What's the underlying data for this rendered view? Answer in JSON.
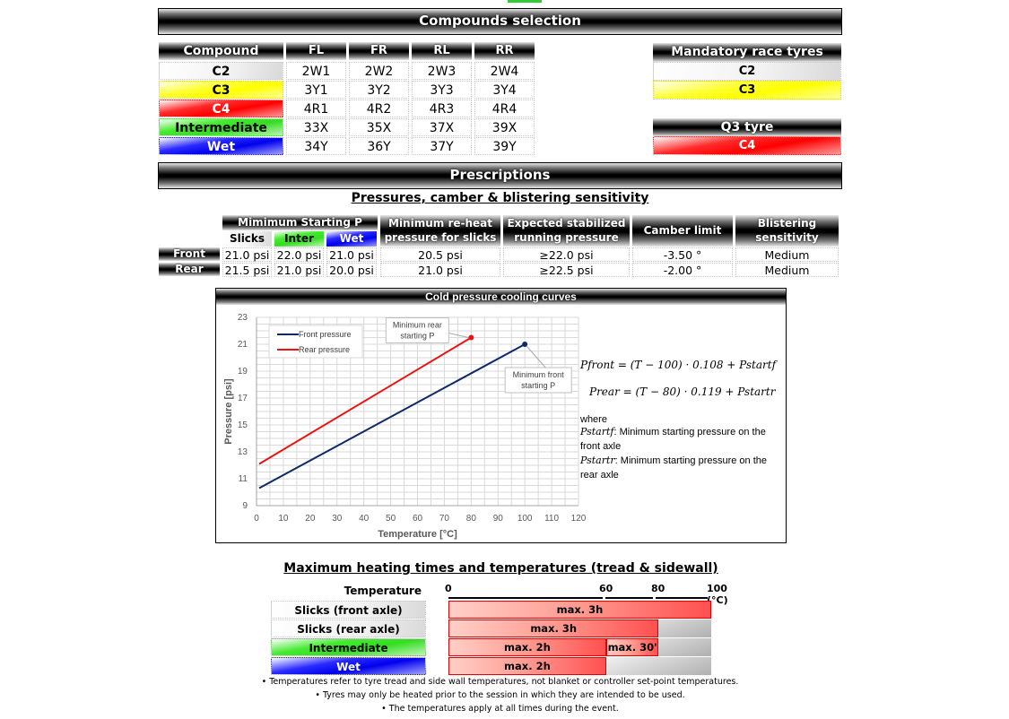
{
  "compounds_section": {
    "title": "Compounds selection",
    "table": {
      "headers": [
        "Compound",
        "FL",
        "FR",
        "RL",
        "RR"
      ],
      "rows": [
        {
          "compound": "C2",
          "color": "white",
          "FL": "2W1",
          "FR": "2W2",
          "RL": "2W3",
          "RR": "2W4"
        },
        {
          "compound": "C3",
          "color": "yellow",
          "FL": "3Y1",
          "FR": "3Y2",
          "RL": "3Y3",
          "RR": "3Y4"
        },
        {
          "compound": "C4",
          "color": "red",
          "FL": "4R1",
          "FR": "4R2",
          "RL": "4R3",
          "RR": "4R4"
        },
        {
          "compound": "Intermediate",
          "color": "green",
          "FL": "33X",
          "FR": "35X",
          "RL": "37X",
          "RR": "39X"
        },
        {
          "compound": "Wet",
          "color": "blue",
          "FL": "34Y",
          "FR": "36Y",
          "RL": "37Y",
          "RR": "39Y"
        }
      ]
    },
    "mandatory": {
      "title": "Mandatory race tyres",
      "items": [
        "C2",
        "C3"
      ]
    },
    "q3": {
      "title": "Q3 tyre",
      "items": [
        "C4"
      ]
    }
  },
  "prescriptions": {
    "title": "Prescriptions",
    "subtitle": "Pressures, camber & blistering sensitivity",
    "table": {
      "group_header": "Mimimum Starting P",
      "sub_headers": [
        "Slicks",
        "Inter",
        "Wet"
      ],
      "headers": [
        "Minimum re-heat pressure for slicks",
        "Expected stabilized running pressure",
        "Camber limit",
        "Blistering sensitivity"
      ],
      "rows": [
        {
          "axle": "Front",
          "slicks": "21.0 psi",
          "inter": "22.0 psi",
          "wet": "21.0 psi",
          "reheat": "20.5 psi",
          "running": "≥22.0 psi",
          "camber": "-3.50 °",
          "blistering": "Medium"
        },
        {
          "axle": "Rear",
          "slicks": "21.5 psi",
          "inter": "21.0 psi",
          "wet": "20.0 psi",
          "reheat": "21.0 psi",
          "running": "≥22.5 psi",
          "camber": "-2.00 °",
          "blistering": "Medium"
        }
      ]
    }
  },
  "chart_data": {
    "type": "line",
    "title": "Cold pressure cooling curves",
    "xlabel": "Temperature [°C]",
    "ylabel": "Pressure [psi]",
    "xlim": [
      0,
      120
    ],
    "ylim": [
      9,
      23
    ],
    "xticks": [
      0,
      10,
      20,
      30,
      40,
      50,
      60,
      70,
      80,
      90,
      100,
      110,
      120
    ],
    "yticks": [
      9,
      11,
      13,
      15,
      17,
      19,
      21,
      23
    ],
    "grid": true,
    "legend": "top-left",
    "series": [
      {
        "name": "Front pressure",
        "color": "#0d2a66",
        "x": [
          1,
          100
        ],
        "y": [
          10.3,
          21.0
        ],
        "end_marker": true
      },
      {
        "name": "Rear pressure",
        "color": "#ee1111",
        "x": [
          1,
          80
        ],
        "y": [
          12.1,
          21.5
        ],
        "end_marker": true
      }
    ],
    "annotations": [
      {
        "text": [
          "Minimum rear",
          "starting P"
        ],
        "x": 80,
        "y": 21.5
      },
      {
        "text": [
          "Minimum front",
          "starting P"
        ],
        "x": 100,
        "y": 21.0
      }
    ]
  },
  "formulas": {
    "front": "Pfront = (T − 100) · 0.108 + Pstartf",
    "rear": "Prear = (T − 80) · 0.119 + Pstartr",
    "where": "where",
    "def1_var": "Pstartf",
    "def1_text": ": Minimum starting pressure on the front axle",
    "def2_var": "Pstartr",
    "def2_text": ": Minimum starting pressure on the rear axle"
  },
  "heating": {
    "title": "Maximum heating times and temperatures (tread & sidewall)",
    "temp_label": "Temperature",
    "scale_labels": [
      "0",
      "60",
      "80",
      "100 (°C)"
    ],
    "rows": [
      {
        "label": "Slicks (front axle)",
        "color": "white",
        "segments": [
          {
            "text": "max. 3h",
            "from": 0,
            "to": 100
          }
        ]
      },
      {
        "label": "Slicks (rear axle)",
        "color": "white",
        "segments": [
          {
            "text": "max. 3h",
            "from": 0,
            "to": 80
          }
        ]
      },
      {
        "label": "Intermediate",
        "color": "green",
        "segments": [
          {
            "text": "max. 2h",
            "from": 0,
            "to": 60
          },
          {
            "text": "max. 30'",
            "from": 60,
            "to": 80
          }
        ]
      },
      {
        "label": "Wet",
        "color": "blue",
        "segments": [
          {
            "text": "max. 2h",
            "from": 0,
            "to": 60
          }
        ]
      }
    ],
    "notes": [
      "• Temperatures refer to tyre tread and side wall temperatures, not blanket or controller set-point temperatures.",
      "• Tyres may only be heated prior to the session in which they are intended to be used.",
      "• The temperatures apply at all times during the event."
    ]
  }
}
